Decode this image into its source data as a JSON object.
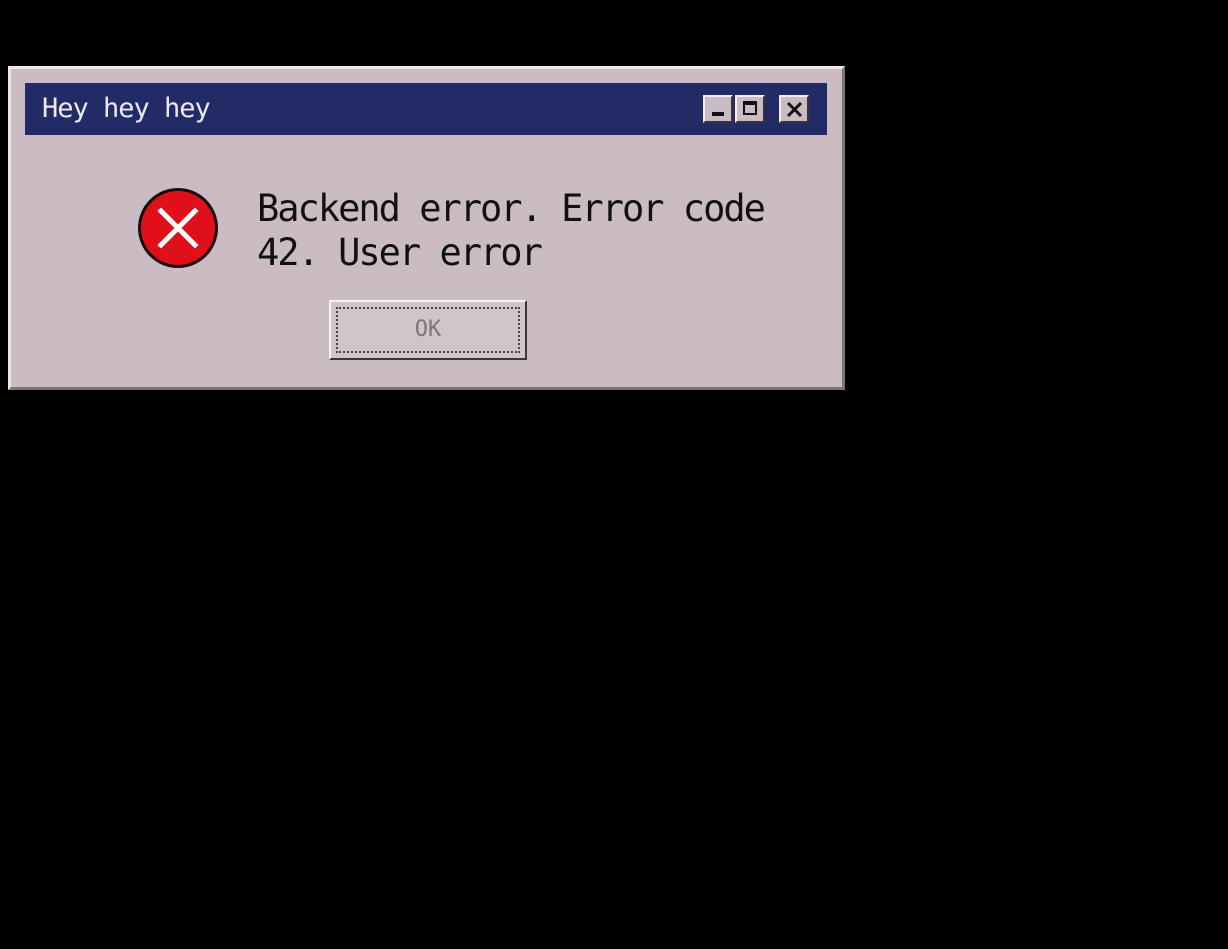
{
  "window": {
    "title": "Hey hey hey",
    "controls": {
      "minimize_icon": "minimize-icon",
      "maximize_icon": "maximize-icon",
      "close_icon": "close-icon"
    }
  },
  "dialog": {
    "icon": "error-icon",
    "message": "Backend error. Error code 42. User error",
    "ok_label": "OK"
  },
  "colors": {
    "background": "#000000",
    "dialog_face": "#cbbcc4",
    "titlebar": "#222b66",
    "title_text": "#ece7f2",
    "error_red": "#e0101a",
    "message_text": "#111111",
    "disabled_text": "#7e7679"
  }
}
